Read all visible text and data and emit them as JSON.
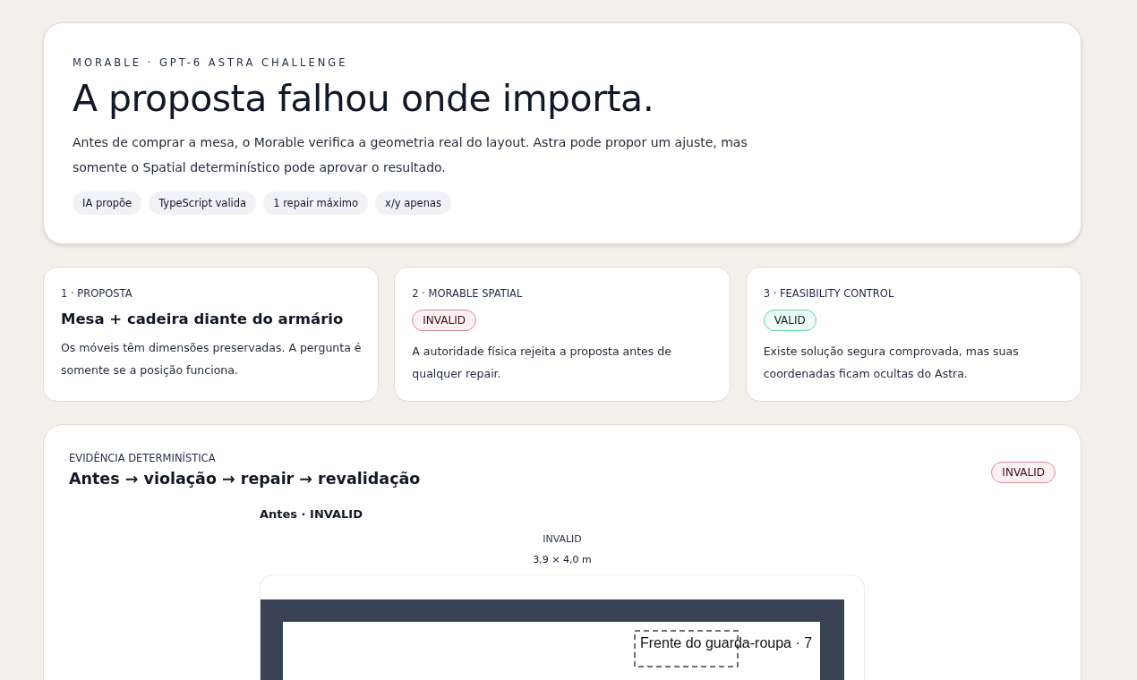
{
  "hero": {
    "eyebrow": "MORABLE · GPT-6 ASTRA CHALLENGE",
    "title": "A proposta falhou onde importa.",
    "lead": "Antes de comprar a mesa, o Morable verifica a geometria real do layout. Astra pode propor um ajuste, mas somente o Spatial determinístico pode aprovar o resultado.",
    "chips": [
      "IA propõe",
      "TypeScript valida",
      "1 repair máximo",
      "x/y apenas"
    ]
  },
  "steps": [
    {
      "label": "1 · PROPOSTA",
      "kind": "title",
      "title": "Mesa + cadeira diante do armário",
      "text": "Os móveis têm dimensões preservadas. A pergunta é somente se a posição funciona."
    },
    {
      "label": "2 · MORABLE SPATIAL",
      "kind": "status",
      "valid": false,
      "badge": "INVALID",
      "text": "A autoridade física rejeita a proposta antes de qualquer repair."
    },
    {
      "label": "3 · FEASIBILITY CONTROL",
      "kind": "status",
      "valid": true,
      "badge": "VALID",
      "text": "Existe solução segura comprovada, mas suas coordenadas ficam ocultas do Astra."
    }
  ],
  "evidence": {
    "eyebrow": "EVIDÊNCIA DETERMINÍSTICA",
    "title": "Antes → violação → repair → revalidação",
    "valid": false,
    "badge": "INVALID",
    "panel": {
      "title": "Antes · INVALID",
      "status_label": "INVALID",
      "dimensions": "3,9 × 4,0 m",
      "zone_label": "Frente do guarda-roupa · 7"
    }
  }
}
